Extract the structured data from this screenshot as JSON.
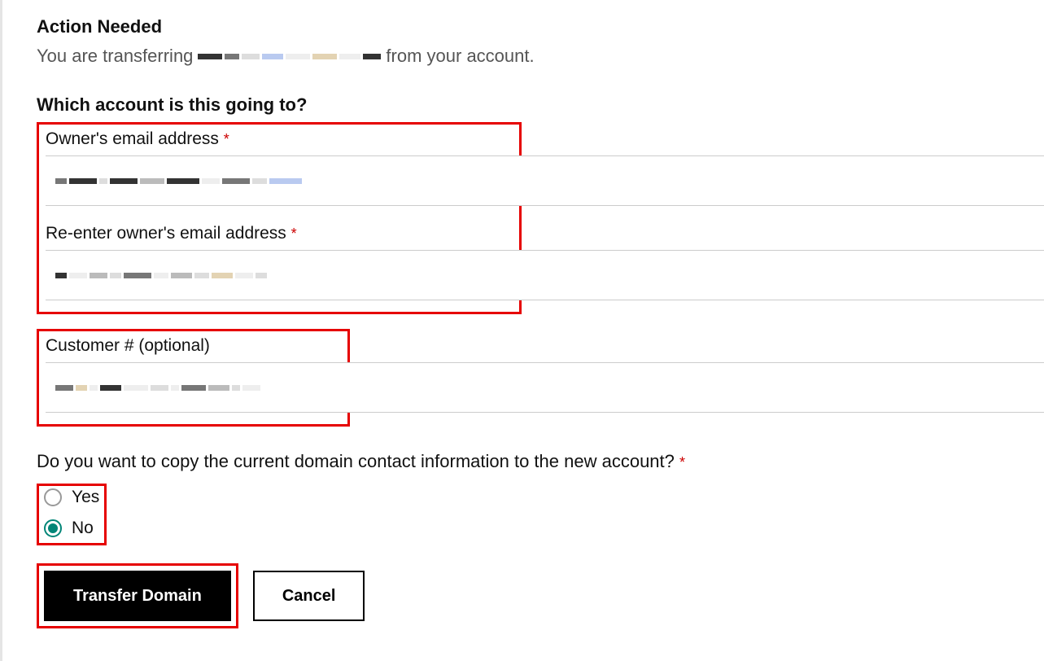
{
  "header": {
    "title": "Action Needed",
    "subtext_prefix": "You are transferring",
    "subtext_suffix": "from your account."
  },
  "section_account": {
    "question": "Which account is this going to?",
    "owner_email_label": "Owner's email address",
    "reenter_email_label": "Re-enter owner's email address",
    "customer_label": "Customer # (optional)"
  },
  "section_copy": {
    "question": "Do you want to copy the current domain contact information to the new account?",
    "option_yes": "Yes",
    "option_no": "No",
    "selected": "no"
  },
  "buttons": {
    "transfer": "Transfer Domain",
    "cancel": "Cancel"
  }
}
